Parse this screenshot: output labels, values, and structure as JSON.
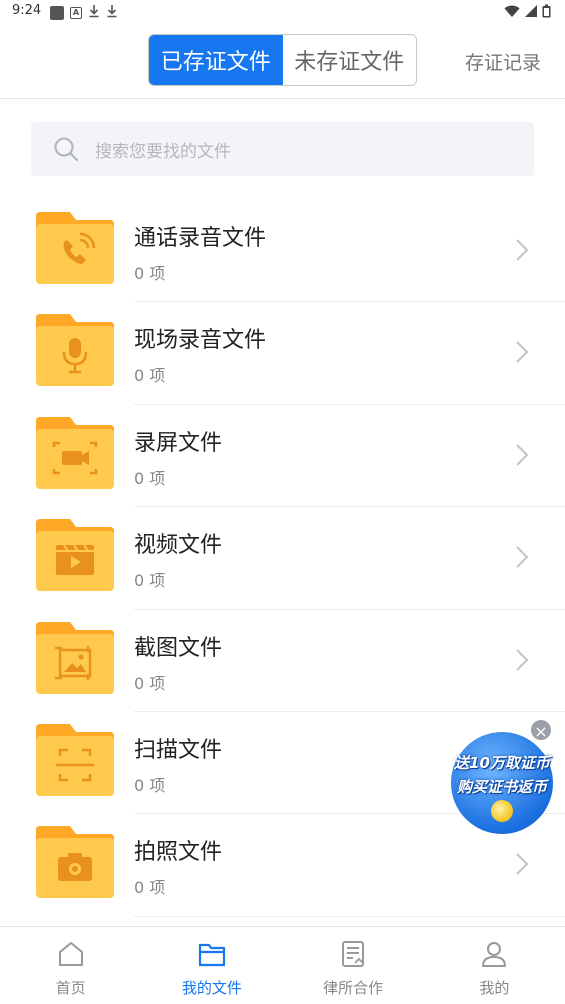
{
  "status_bar": {
    "time": "9:24",
    "notif_a": "A"
  },
  "header": {
    "tabs": [
      {
        "label": "已存证文件",
        "active": true
      },
      {
        "label": "未存证文件",
        "active": false
      }
    ],
    "records_link": "存证记录"
  },
  "search": {
    "placeholder": "搜索您要找的文件"
  },
  "files": [
    {
      "title": "通话录音文件",
      "count": "0 项",
      "icon": "phone-icon"
    },
    {
      "title": "现场录音文件",
      "count": "0 项",
      "icon": "microphone-icon"
    },
    {
      "title": "录屏文件",
      "count": "0 项",
      "icon": "screen-record-icon"
    },
    {
      "title": "视频文件",
      "count": "0 项",
      "icon": "video-icon"
    },
    {
      "title": "截图文件",
      "count": "0 项",
      "icon": "screenshot-icon"
    },
    {
      "title": "扫描文件",
      "count": "0 项",
      "icon": "scan-icon"
    },
    {
      "title": "拍照文件",
      "count": "0 项",
      "icon": "camera-icon"
    }
  ],
  "promo": {
    "line1": "送10万取证币",
    "line2": "购买证书返币",
    "close": "×"
  },
  "bottom_nav": [
    {
      "label": "首页",
      "icon": "home-icon",
      "active": false
    },
    {
      "label": "我的文件",
      "icon": "folder-icon",
      "active": true
    },
    {
      "label": "律所合作",
      "icon": "document-icon",
      "active": false
    },
    {
      "label": "我的",
      "icon": "user-icon",
      "active": false
    }
  ],
  "colors": {
    "accent": "#1677f0",
    "folder": "#ffc94d",
    "folder_tab": "#ffa726",
    "folder_glyph": "#e8911c"
  }
}
